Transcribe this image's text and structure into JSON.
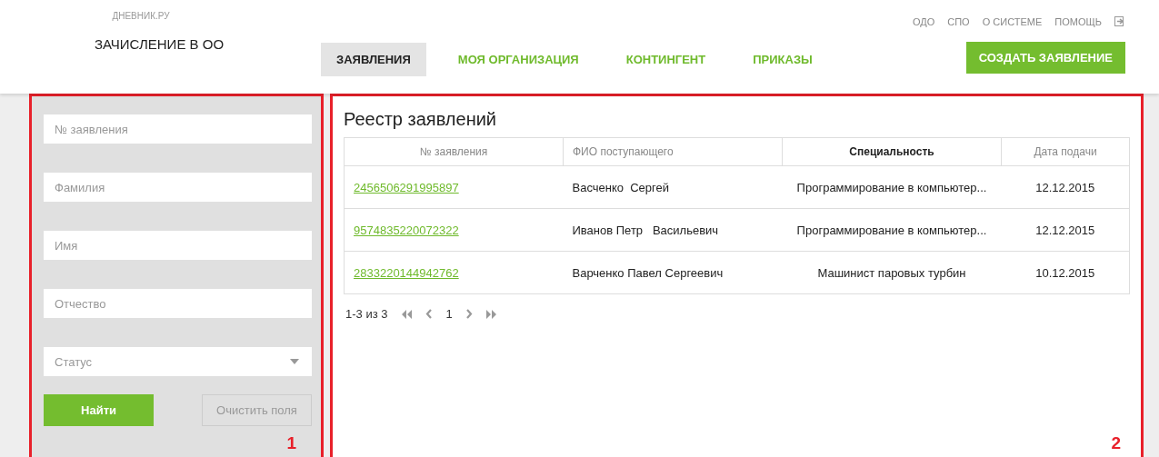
{
  "header": {
    "brand": "ДНЕВНИК.РУ",
    "module_title": "ЗАЧИСЛЕНИЕ В ОО",
    "top_links": [
      "ОДО",
      "СПО",
      "О СИСТЕМЕ",
      "ПОМОЩЬ"
    ],
    "tabs": [
      {
        "label": "ЗАЯВЛЕНИЯ",
        "selected": true
      },
      {
        "label": "МОЯ ОРГАНИЗАЦИЯ",
        "selected": false
      },
      {
        "label": "КОНТИНГЕНТ",
        "selected": false
      },
      {
        "label": "ПРИКАЗЫ",
        "selected": false
      }
    ],
    "create_button": "СОЗДАТЬ ЗАЯВЛЕНИЕ"
  },
  "filters": {
    "fields": [
      {
        "kind": "text",
        "placeholder": "№ заявления"
      },
      {
        "kind": "text",
        "placeholder": "Фамилия"
      },
      {
        "kind": "text",
        "placeholder": "Имя"
      },
      {
        "kind": "text",
        "placeholder": "Отчество"
      },
      {
        "kind": "select",
        "placeholder": "Статус"
      }
    ],
    "search_button": "Найти",
    "clear_button": "Очистить поля",
    "annotation": "1"
  },
  "registry": {
    "title": "Реестр заявлений",
    "annotation": "2",
    "columns": [
      {
        "label": "№ заявления",
        "sorted": false
      },
      {
        "label": "ФИО поступающего",
        "sorted": false
      },
      {
        "label": "Специальность",
        "sorted": true
      },
      {
        "label": "Дата подачи",
        "sorted": false
      }
    ],
    "rows": [
      [
        "2456506291995897",
        "Васченко  Сергей",
        "Программирование в компьютер...",
        "12.12.2015"
      ],
      [
        "9574835220072322",
        "Иванов Петр   Васильевич",
        "Программирование в компьютер...",
        "12.12.2015"
      ],
      [
        "2833220144942762",
        "Варченко Павел Сергеевич",
        "Машинист паровых турбин",
        "10.12.2015"
      ]
    ],
    "pagination": {
      "range": "1-3 из 3",
      "page": "1"
    }
  }
}
